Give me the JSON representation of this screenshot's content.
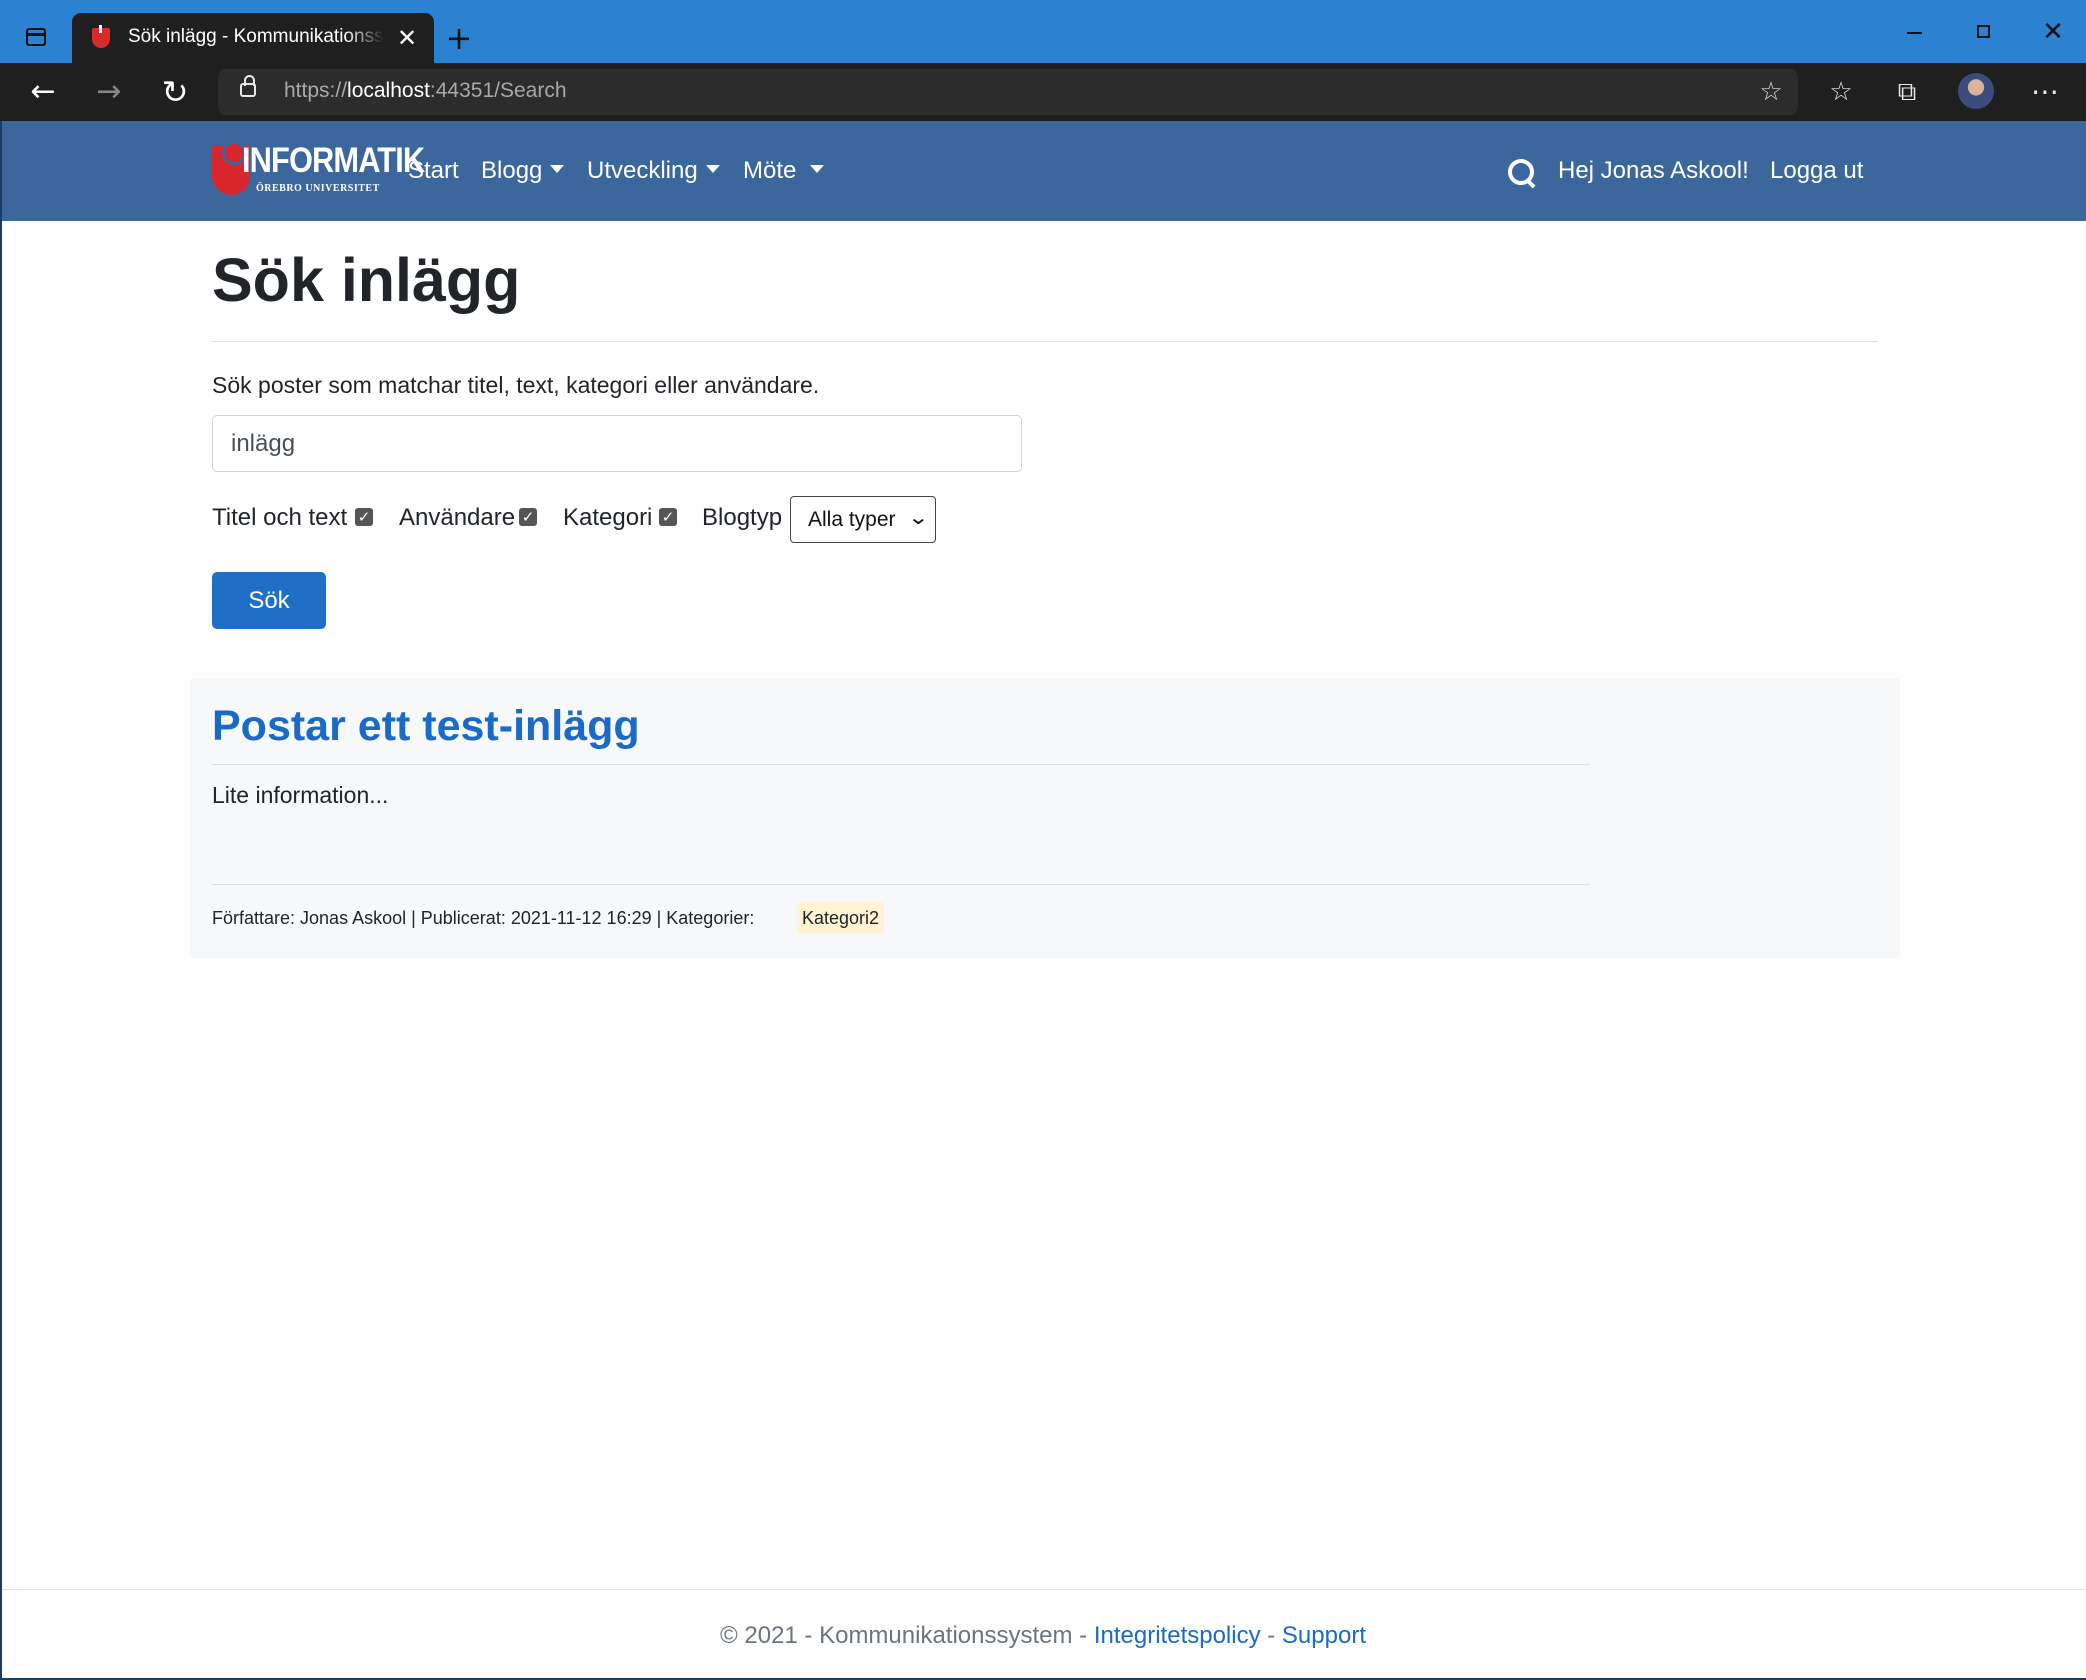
{
  "browser": {
    "tab_title": "Sök inlägg - Kommunikationssystem",
    "tab_close": "✕",
    "new_tab": "+",
    "url_scheme": "https://",
    "url_host": "localhost",
    "url_rest": ":44351/Search",
    "window_close": "✕",
    "icons": [
      "tab-actions-icon",
      "back-arrow-icon",
      "forward-arrow-icon",
      "reload-icon",
      "lock-icon",
      "add-favorite-icon",
      "favorites-icon",
      "collections-icon",
      "profile-avatar",
      "more-icon"
    ]
  },
  "navbar": {
    "logo_text": "INFORMATIK",
    "logo_sub": "ÖREBRO UNIVERSITET",
    "links": {
      "start": "Start",
      "blogg": "Blogg",
      "utveckling": "Utveckling",
      "mote": "Möte"
    },
    "greeting": "Hej Jonas Askool!",
    "logout": "Logga ut",
    "background": "#3c679c"
  },
  "main": {
    "title": "Sök inlägg",
    "description": "Sök poster som matchar titel, text, kategori eller användare.",
    "search_value": "inlägg",
    "filters": {
      "titel_label": "Titel och text",
      "titel_checked": true,
      "anvandare_label": "Användare",
      "anvandare_checked": true,
      "kategori_label": "Kategori",
      "kategori_checked": true,
      "blogtyp_label": "Blogtyp",
      "blogtyp_selected": "Alla typer"
    },
    "search_button": "Sök",
    "accent": "#1e6fc5"
  },
  "results": [
    {
      "title": "Postar ett test-inlägg",
      "body": "Lite information...",
      "meta": "Författare: Jonas Askool | Publicerat: 2021-11-12 16:29 | Kategorier:",
      "tag": "Kategori2"
    }
  ],
  "footer": {
    "text": "© 2021 - Kommunikationssystem - ",
    "privacy": "Integritetspolicy",
    "separator": " - ",
    "support": "Support"
  }
}
